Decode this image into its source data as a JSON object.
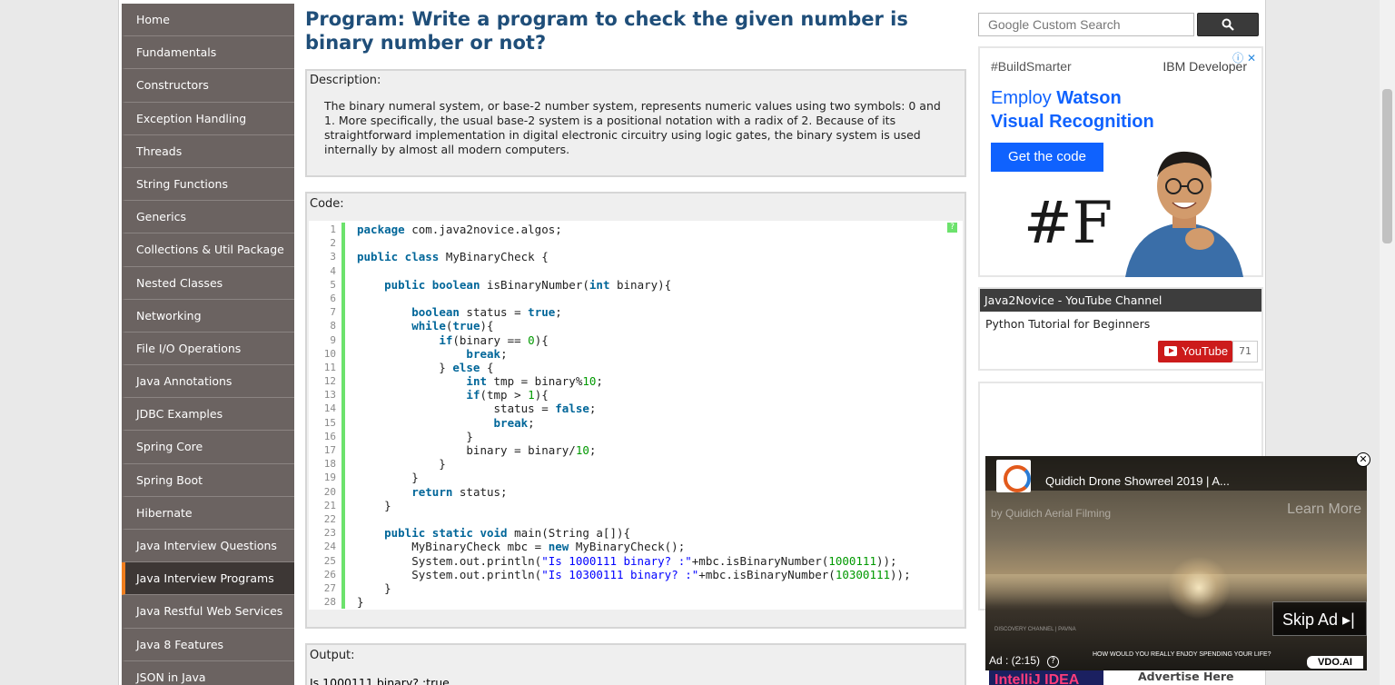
{
  "sidebar": {
    "items": [
      {
        "label": "Home",
        "active": false
      },
      {
        "label": "Fundamentals",
        "active": false
      },
      {
        "label": "Constructors",
        "active": false
      },
      {
        "label": "Exception Handling",
        "active": false
      },
      {
        "label": "Threads",
        "active": false
      },
      {
        "label": "String Functions",
        "active": false
      },
      {
        "label": "Generics",
        "active": false
      },
      {
        "label": "Collections & Util Package",
        "active": false
      },
      {
        "label": "Nested Classes",
        "active": false
      },
      {
        "label": "Networking",
        "active": false
      },
      {
        "label": "File I/O Operations",
        "active": false
      },
      {
        "label": "Java Annotations",
        "active": false
      },
      {
        "label": "JDBC Examples",
        "active": false
      },
      {
        "label": "Spring Core",
        "active": false
      },
      {
        "label": "Spring Boot",
        "active": false
      },
      {
        "label": "Hibernate",
        "active": false
      },
      {
        "label": "Java Interview Questions",
        "active": false
      },
      {
        "label": "Java Interview Programs",
        "active": true
      },
      {
        "label": "Java Restful Web Services",
        "active": false
      },
      {
        "label": "Java 8 Features",
        "active": false
      },
      {
        "label": "JSON in Java",
        "active": false
      }
    ]
  },
  "main": {
    "title": "Program: Write a program to check the given number is binary number or not?",
    "description_label": "Description:",
    "description_text": "The binary numeral system, or base-2 number system, represents numeric values using two symbols: 0 and 1. More specifically, the usual base-2 system is a positional notation with a radix of 2. Because of its straightforward implementation in digital electronic circuitry using logic gates, the binary system is used internally by almost all modern computers.",
    "code_label": "Code:",
    "code_help": "?",
    "code_lines": [
      [
        {
          "t": "kw",
          "v": "package"
        },
        {
          "t": "p",
          "v": " com.java2novice.algos;"
        }
      ],
      [],
      [
        {
          "t": "kw",
          "v": "public class"
        },
        {
          "t": "p",
          "v": " MyBinaryCheck {"
        }
      ],
      [],
      [
        {
          "t": "p",
          "v": "    "
        },
        {
          "t": "kw",
          "v": "public boolean"
        },
        {
          "t": "p",
          "v": " isBinaryNumber("
        },
        {
          "t": "kw",
          "v": "int"
        },
        {
          "t": "p",
          "v": " binary){"
        }
      ],
      [],
      [
        {
          "t": "p",
          "v": "        "
        },
        {
          "t": "kw",
          "v": "boolean"
        },
        {
          "t": "p",
          "v": " status = "
        },
        {
          "t": "kw",
          "v": "true"
        },
        {
          "t": "p",
          "v": ";"
        }
      ],
      [
        {
          "t": "p",
          "v": "        "
        },
        {
          "t": "kw",
          "v": "while"
        },
        {
          "t": "p",
          "v": "("
        },
        {
          "t": "kw",
          "v": "true"
        },
        {
          "t": "p",
          "v": "){"
        }
      ],
      [
        {
          "t": "p",
          "v": "            "
        },
        {
          "t": "kw",
          "v": "if"
        },
        {
          "t": "p",
          "v": "(binary == "
        },
        {
          "t": "num",
          "v": "0"
        },
        {
          "t": "p",
          "v": "){"
        }
      ],
      [
        {
          "t": "p",
          "v": "                "
        },
        {
          "t": "kw",
          "v": "break"
        },
        {
          "t": "p",
          "v": ";"
        }
      ],
      [
        {
          "t": "p",
          "v": "            } "
        },
        {
          "t": "kw",
          "v": "else"
        },
        {
          "t": "p",
          "v": " {"
        }
      ],
      [
        {
          "t": "p",
          "v": "                "
        },
        {
          "t": "kw",
          "v": "int"
        },
        {
          "t": "p",
          "v": " tmp = binary%"
        },
        {
          "t": "num",
          "v": "10"
        },
        {
          "t": "p",
          "v": ";"
        }
      ],
      [
        {
          "t": "p",
          "v": "                "
        },
        {
          "t": "kw",
          "v": "if"
        },
        {
          "t": "p",
          "v": "(tmp > "
        },
        {
          "t": "num",
          "v": "1"
        },
        {
          "t": "p",
          "v": "){"
        }
      ],
      [
        {
          "t": "p",
          "v": "                    status = "
        },
        {
          "t": "kw",
          "v": "false"
        },
        {
          "t": "p",
          "v": ";"
        }
      ],
      [
        {
          "t": "p",
          "v": "                    "
        },
        {
          "t": "kw",
          "v": "break"
        },
        {
          "t": "p",
          "v": ";"
        }
      ],
      [
        {
          "t": "p",
          "v": "                }"
        }
      ],
      [
        {
          "t": "p",
          "v": "                binary = binary/"
        },
        {
          "t": "num",
          "v": "10"
        },
        {
          "t": "p",
          "v": ";"
        }
      ],
      [
        {
          "t": "p",
          "v": "            }"
        }
      ],
      [
        {
          "t": "p",
          "v": "        }"
        }
      ],
      [
        {
          "t": "p",
          "v": "        "
        },
        {
          "t": "kw",
          "v": "return"
        },
        {
          "t": "p",
          "v": " status;"
        }
      ],
      [
        {
          "t": "p",
          "v": "    }"
        }
      ],
      [],
      [
        {
          "t": "p",
          "v": "    "
        },
        {
          "t": "kw",
          "v": "public static void"
        },
        {
          "t": "p",
          "v": " main(String a[]){"
        }
      ],
      [
        {
          "t": "p",
          "v": "        MyBinaryCheck mbc = "
        },
        {
          "t": "kw",
          "v": "new"
        },
        {
          "t": "p",
          "v": " MyBinaryCheck();"
        }
      ],
      [
        {
          "t": "p",
          "v": "        System.out.println("
        },
        {
          "t": "str",
          "v": "\"Is 1000111 binary? :\""
        },
        {
          "t": "p",
          "v": "+mbc.isBinaryNumber("
        },
        {
          "t": "num",
          "v": "1000111"
        },
        {
          "t": "p",
          "v": "));"
        }
      ],
      [
        {
          "t": "p",
          "v": "        System.out.println("
        },
        {
          "t": "str",
          "v": "\"Is 10300111 binary? :\""
        },
        {
          "t": "p",
          "v": "+mbc.isBinaryNumber("
        },
        {
          "t": "num",
          "v": "10300111"
        },
        {
          "t": "p",
          "v": "));"
        }
      ],
      [
        {
          "t": "p",
          "v": "    }"
        }
      ],
      [
        {
          "t": "p",
          "v": "}"
        }
      ]
    ],
    "output_label": "Output:",
    "output_text": "Is 1000111 binary? :true"
  },
  "search": {
    "placeholder": "Google Custom Search",
    "button_icon": "search-icon"
  },
  "ad": {
    "tag": "#BuildSmarter",
    "brand": "IBM Developer",
    "headline_1": "Employ",
    "headline_2": "Watson",
    "headline_3": "Visual Recognition",
    "button": "Get the code",
    "logo": "#F",
    "close": "ⓘ ✕",
    "accent": "#0f62fe"
  },
  "youtube": {
    "header": "Java2Novice - YouTube Channel",
    "video_title": "Python Tutorial for Beginners",
    "button": "YouTube",
    "count": "71",
    "color": "#cc1b1b"
  },
  "video_ad": {
    "title": "Quidich Drone Showreel 2019 | A...",
    "channel": "by Quidich Aerial Filming",
    "learn_more": "Learn More",
    "skip": "Skip Ad ▸|",
    "time": "Ad : (2:15)",
    "caption": "HOW WOULD YOU REALLY ENJOY SPENDING YOUR LIFE?",
    "watermark": "DISCOVERY CHANNEL | PAVNA",
    "brand": "VDO.AI",
    "close": "✕"
  },
  "footer": {
    "bottom_ad": "IntelliJ IDEA",
    "advertise": "Advertise Here"
  }
}
